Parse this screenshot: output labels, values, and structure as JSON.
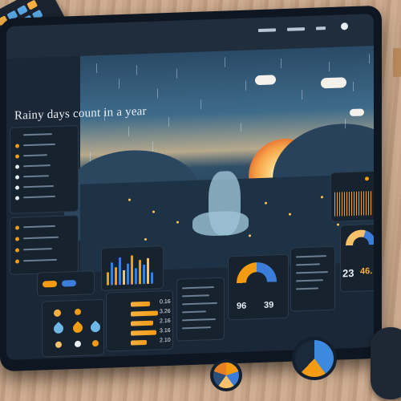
{
  "dashboard": {
    "title": "Rainy days count in a year",
    "top_nav": [
      "",
      "",
      ""
    ]
  },
  "stats": {
    "list_values": [
      "0.16",
      "3.26",
      "2.16",
      "3.16",
      "2.10"
    ],
    "gauge_left_value": "96",
    "gauge_right_value": "39",
    "summary_value_left": "23",
    "summary_value_right": "46."
  },
  "colors": {
    "accent_orange": "#f39c12",
    "accent_blue": "#3b7dd8",
    "panel_bg": "#17222f",
    "screen_bg": "#1a2736"
  },
  "icons": [
    "sun-icon",
    "cloud-icon",
    "raindrop-icon",
    "gauge-icon"
  ]
}
